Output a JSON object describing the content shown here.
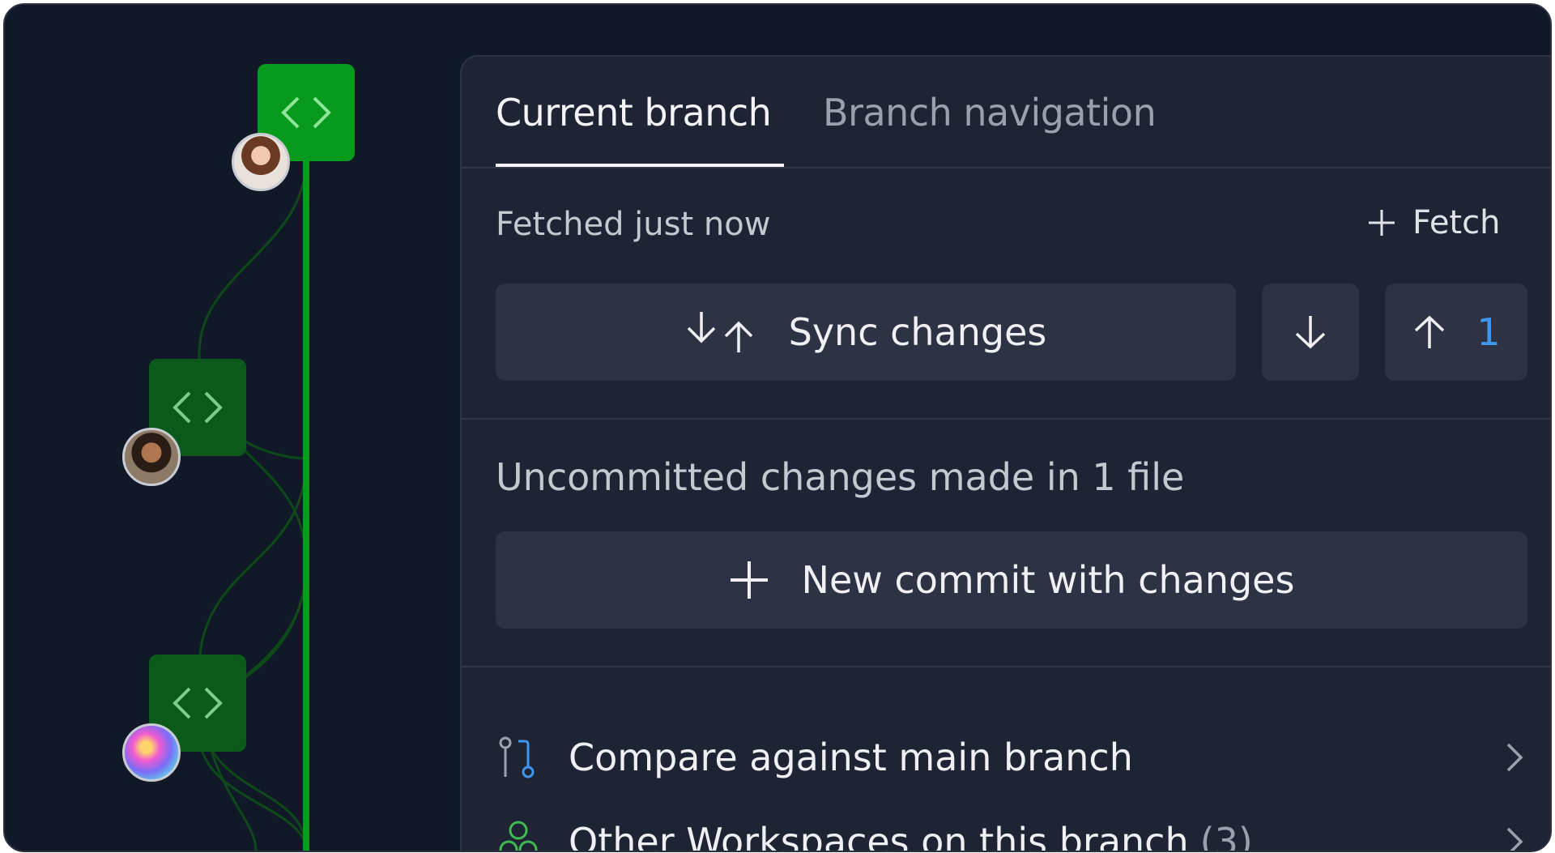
{
  "tabs": [
    {
      "label": "Current branch",
      "active": true
    },
    {
      "label": "Branch navigation",
      "active": false
    }
  ],
  "status": {
    "fetched_text": "Fetched just now",
    "fetch_label": "Fetch"
  },
  "sync": {
    "label": "Sync changes",
    "push_count": "1"
  },
  "changes": {
    "summary": "Uncommitted changes made in 1 file",
    "commit_label": "New commit with changes"
  },
  "links": [
    {
      "label": "Compare against main branch",
      "icon": "compare-branch-icon"
    },
    {
      "label": "Other Workspaces on this branch",
      "count": "(3)",
      "icon": "workspaces-icon"
    }
  ],
  "colors": {
    "background": "#111827",
    "panel": "#1f2434",
    "button": "#2d3244",
    "accent_green": "#079a1c",
    "accent_blue": "#3e97ef",
    "text": "#eef0f4",
    "muted": "#9aa0ac"
  }
}
